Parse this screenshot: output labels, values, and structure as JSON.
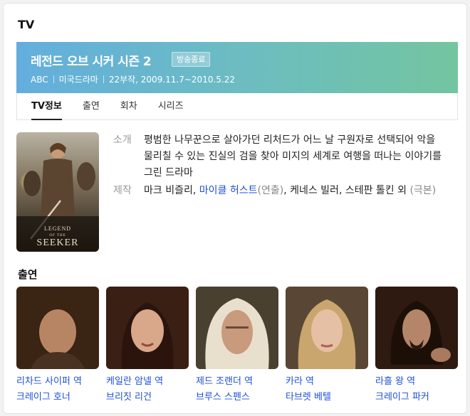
{
  "section": {
    "title": "TV"
  },
  "banner": {
    "title": "레전드 오브 시커 시즌 2",
    "badge": "방송종료",
    "network": "ABC",
    "genre": "미국드라마",
    "episodes_dates": "22부작, 2009.11.7~2010.5.22",
    "gradient_start": "#63aede",
    "gradient_end": "#73c5a0"
  },
  "tabs": [
    {
      "label": "TV정보",
      "active": true
    },
    {
      "label": "출연",
      "active": false
    },
    {
      "label": "회차",
      "active": false
    },
    {
      "label": "시리즈",
      "active": false
    }
  ],
  "poster": {
    "logo_line1": "LEGEND",
    "logo_line2": "OF THE",
    "logo_line3": "SEEKER"
  },
  "info": {
    "synopsis_label": "소개",
    "synopsis": "평범한 나무꾼으로 살아가던 리처드가 어느 날 구원자로 선택되어 악을 물리칠 수 있는 진실의 검을 찾아 미지의 세계로 여행을 떠나는 이야기를 그린 드라마",
    "production_label": "제작",
    "production_1": "마크 비즐리, ",
    "production_link": "마이클 허스트",
    "production_role1": "(연출)",
    "production_2": ", 케네스 빌러, 스테판 톨킨 외 ",
    "production_role2": "(극본)"
  },
  "cast": {
    "title": "출연",
    "members": [
      {
        "role": "리차드 사이퍼 역",
        "actor": "크레이그 호너"
      },
      {
        "role": "케일란 암넬 역",
        "actor": "브리짓 리건"
      },
      {
        "role": "제드 조랜더 역",
        "actor": "브루스 스펜스"
      },
      {
        "role": "카라 역",
        "actor": "타브렛 베텔"
      },
      {
        "role": "라흘 왕 역",
        "actor": "크레이그 파커"
      }
    ]
  }
}
